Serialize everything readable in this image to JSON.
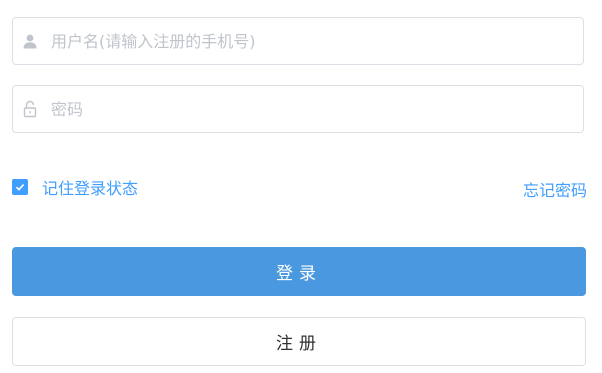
{
  "form": {
    "username": {
      "placeholder": "用户名(请输入注册的手机号)",
      "value": "",
      "icon": "user-icon"
    },
    "password": {
      "placeholder": "密码",
      "value": "",
      "icon": "unlock-icon"
    },
    "remember": {
      "label": "记住登录状态",
      "checked": true
    },
    "forgot_label": "忘记密码",
    "login_label": "登录",
    "register_label": "注册"
  },
  "colors": {
    "accent": "#409eff",
    "login_button": "#4a98e0",
    "border": "#dcdfe6",
    "placeholder": "#c0c4cc",
    "icon": "#c0c4cc"
  }
}
